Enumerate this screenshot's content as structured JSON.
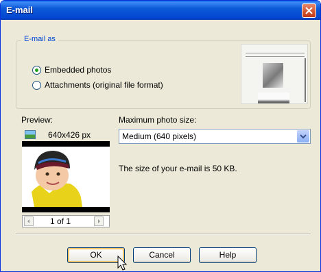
{
  "window": {
    "title": "E-mail"
  },
  "email_as": {
    "group_label": "E-mail as",
    "options": [
      {
        "label": "Embedded photos",
        "selected": true
      },
      {
        "label": "Attachments (original file format)",
        "selected": false
      }
    ]
  },
  "preview": {
    "label": "Preview:",
    "dimensions": "640x426 px",
    "pager": "1 of 1"
  },
  "size": {
    "label": "Maximum photo size:",
    "selected": "Medium (640 pixels)",
    "info": "The size of your e-mail is 50 KB."
  },
  "buttons": {
    "ok": "OK",
    "cancel": "Cancel",
    "help": "Help"
  },
  "colors": {
    "titlebar": "#0a5fe4",
    "group_label": "#0046d5",
    "radio_dot": "#21a121"
  }
}
